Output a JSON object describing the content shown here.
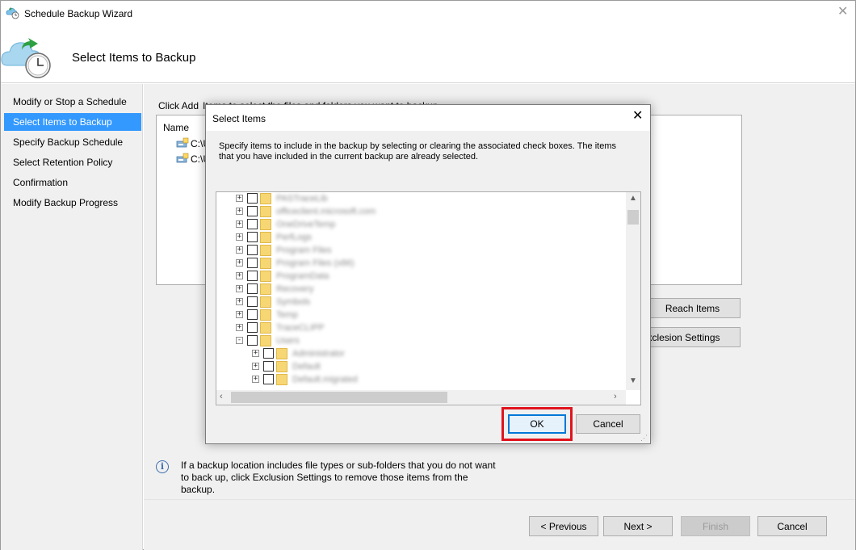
{
  "window": {
    "title": "Schedule Backup Wizard",
    "page_title": "Select Items to Backup"
  },
  "sidebar": {
    "items": [
      {
        "label": "Modify or Stop a Schedule",
        "active": false
      },
      {
        "label": "Select Items to Backup",
        "active": true
      },
      {
        "label": "Specify Backup Schedule",
        "active": false
      },
      {
        "label": "Select Retention Policy",
        "active": false
      },
      {
        "label": "Confirmation",
        "active": false
      },
      {
        "label": "Modify Backup Progress",
        "active": false
      }
    ]
  },
  "main": {
    "instruction_prefix": "Click Add",
    "instruction_rest": "Items to select the files and folders you want to backup.",
    "list": {
      "column_name": "Name",
      "rows": [
        "C:\\U",
        "C:\\U"
      ]
    },
    "buttons": {
      "add_items": "Reach Items",
      "exclusion_settings": "xclesion Settings"
    },
    "info_text": "If a backup location includes file types or sub-folders that you do not want to back up, click Exclusion Settings to remove those items from the backup."
  },
  "footer": {
    "previous": "< Previous",
    "next": "Next >",
    "finish": "Finish",
    "cancel": "Cancel"
  },
  "dialog": {
    "title": "Select Items",
    "description": "Specify items to include in the backup by selecting or clearing the associated check boxes. The items that you have included in the current backup are already selected.",
    "tree": [
      {
        "label": "PASTraceLib",
        "level": 1,
        "expander": "+"
      },
      {
        "label": "officeclient.microsoft.com",
        "level": 1,
        "expander": "+"
      },
      {
        "label": "OneDriveTemp",
        "level": 1,
        "expander": "+"
      },
      {
        "label": "PerfLogs",
        "level": 1,
        "expander": "+"
      },
      {
        "label": "Program Files",
        "level": 1,
        "expander": "+"
      },
      {
        "label": "Program Files (x86)",
        "level": 1,
        "expander": "+"
      },
      {
        "label": "ProgramData",
        "level": 1,
        "expander": "+"
      },
      {
        "label": "Recovery",
        "level": 1,
        "expander": "+"
      },
      {
        "label": "Symbols",
        "level": 1,
        "expander": "+"
      },
      {
        "label": "Temp",
        "level": 1,
        "expander": "+"
      },
      {
        "label": "TraceCLIPP",
        "level": 1,
        "expander": "+"
      },
      {
        "label": "Users",
        "level": 1,
        "expander": "-"
      },
      {
        "label": "Administrator",
        "level": 2,
        "expander": "+"
      },
      {
        "label": "Default",
        "level": 2,
        "expander": "+"
      },
      {
        "label": "Default.migrated",
        "level": 2,
        "expander": "+"
      }
    ],
    "ok": "OK",
    "cancel": "Cancel"
  },
  "colors": {
    "selection": "#3399ff",
    "highlight_box": "#e0141e",
    "ok_border": "#0078d7"
  },
  "icons": [
    "backup-clock-icon",
    "drive-icon",
    "info-icon",
    "folder-icon",
    "close-icon"
  ]
}
